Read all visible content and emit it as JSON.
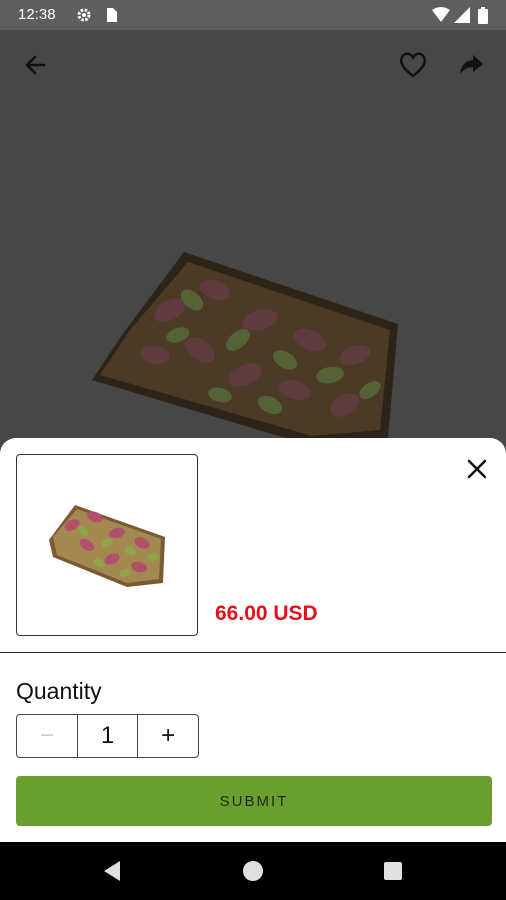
{
  "status_bar": {
    "time": "12:38",
    "icons": [
      "settings-icon",
      "sim-card-icon",
      "wifi-icon",
      "signal-icon",
      "battery-icon"
    ]
  },
  "header": {
    "icons": [
      "back-arrow-icon",
      "heart-icon",
      "share-icon"
    ]
  },
  "product": {
    "image": "pistachio-bar-image",
    "price": "66.00 USD"
  },
  "sheet": {
    "quantity_label": "Quantity",
    "quantity_value": "1",
    "decrement_symbol": "−",
    "increment_symbol": "+",
    "submit_label": "SUBMIT"
  },
  "colors": {
    "price": "#e3101c",
    "submit_bg": "#6a9f2f",
    "overlay": "#474747"
  },
  "nav_bar": {
    "icons": [
      "back-triangle-icon",
      "home-circle-icon",
      "recents-square-icon"
    ]
  }
}
